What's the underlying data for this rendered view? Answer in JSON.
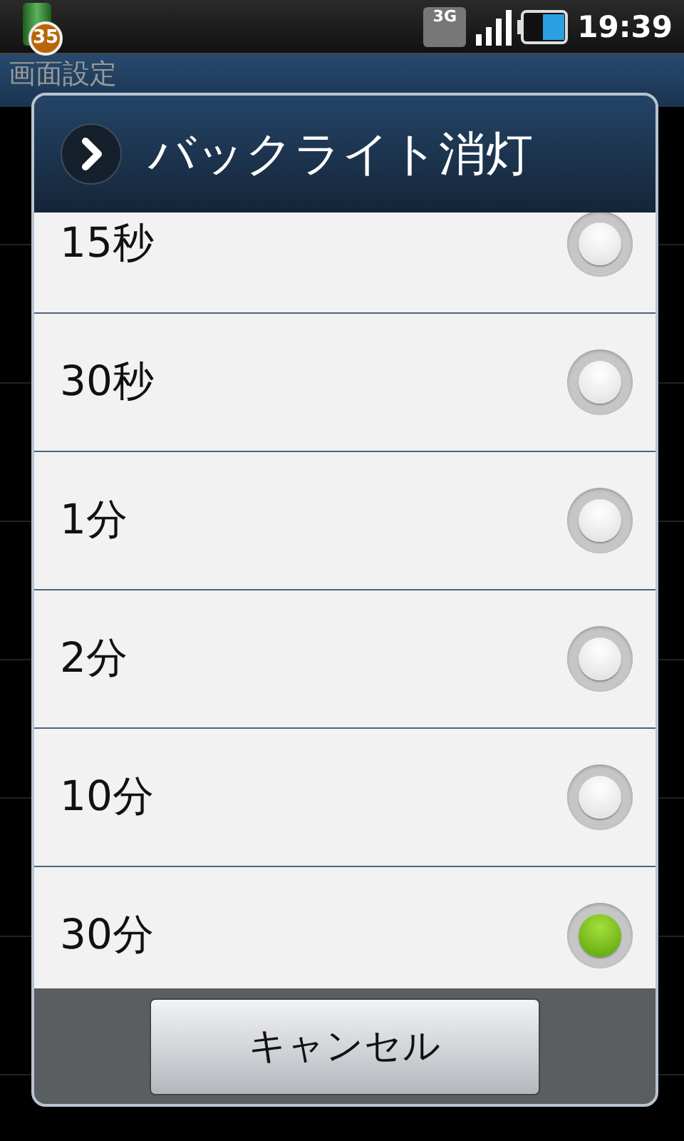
{
  "status_bar": {
    "app_badge": "35",
    "network": "3G",
    "time": "19:39"
  },
  "screen_title": "画面設定",
  "dialog": {
    "title": "バックライト消灯",
    "options": [
      {
        "label": "15秒",
        "selected": false
      },
      {
        "label": "30秒",
        "selected": false
      },
      {
        "label": "1分",
        "selected": false
      },
      {
        "label": "2分",
        "selected": false
      },
      {
        "label": "10分",
        "selected": false
      },
      {
        "label": "30分",
        "selected": true
      }
    ],
    "cancel_button": "キャンセル"
  }
}
